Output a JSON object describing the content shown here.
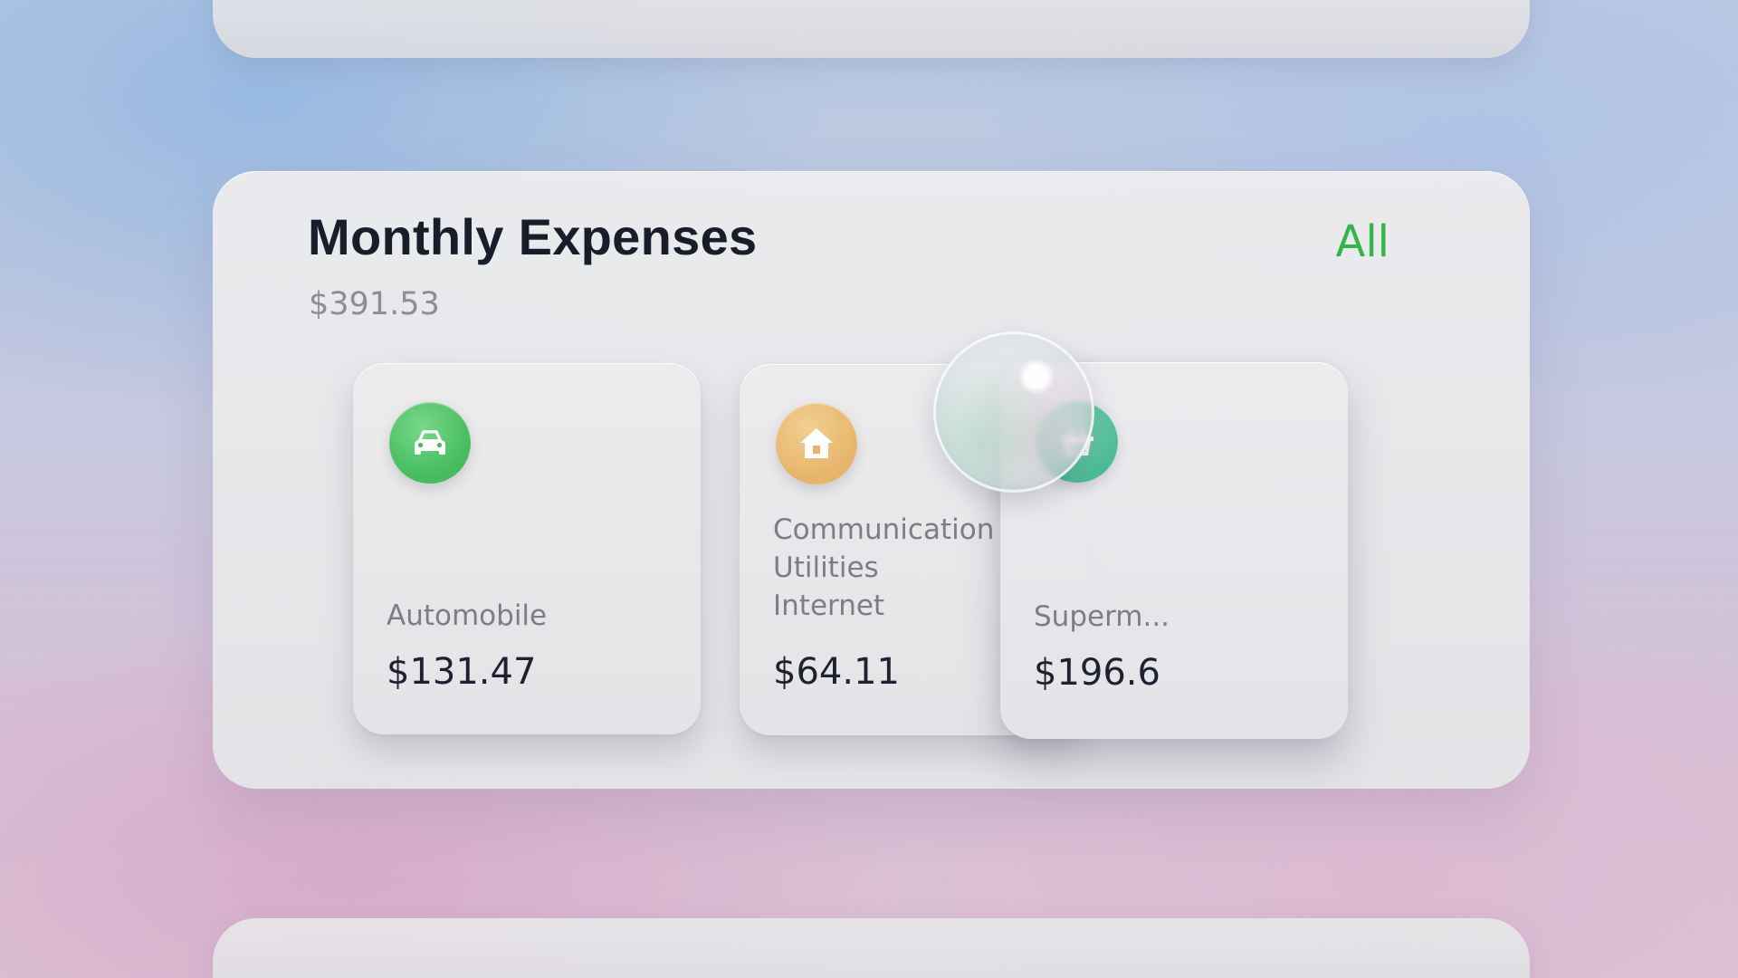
{
  "card": {
    "title": "Monthly Expenses",
    "total": "$391.53",
    "all_link": "All"
  },
  "categories": [
    {
      "icon": "car-icon",
      "color": "#45bb5b",
      "label_lines": [
        "Automobile"
      ],
      "amount": "$131.47"
    },
    {
      "icon": "house-icon",
      "color": "#e6b46a",
      "label_lines": [
        "Communication",
        "Utilities",
        "Internet"
      ],
      "amount": "$64.11"
    },
    {
      "icon": "basket-icon",
      "color": "#4cbc95",
      "label_lines": [
        "Superm..."
      ],
      "amount": "$196.6"
    }
  ],
  "colors": {
    "accent": "#33b54a",
    "title": "#181d2a",
    "muted": "#8b8e94"
  }
}
